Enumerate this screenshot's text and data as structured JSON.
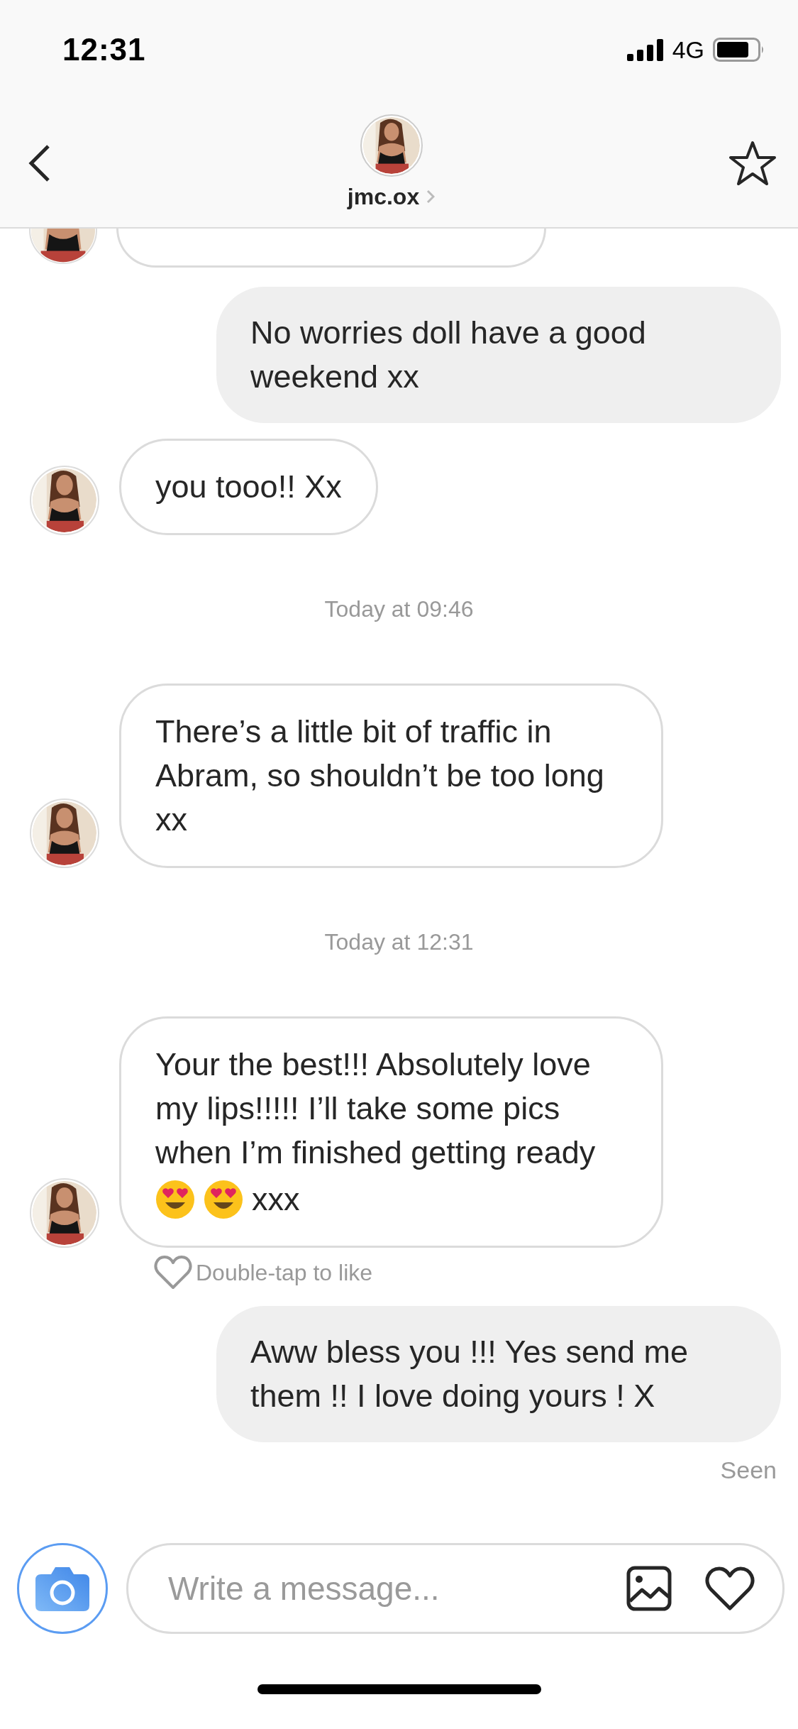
{
  "status_bar": {
    "time": "12:31",
    "network": "4G"
  },
  "header": {
    "username": "jmc.ox"
  },
  "messages": [
    {
      "kind": "partial"
    },
    {
      "kind": "outgoing",
      "parts": [
        {
          "kind": "text",
          "text": "No worries doll have a good weekend xx"
        }
      ]
    },
    {
      "kind": "incoming",
      "parts": [
        {
          "kind": "text",
          "text": "you tooo!! Xx"
        }
      ]
    },
    {
      "kind": "timestamp",
      "text": "Today at 09:46"
    },
    {
      "kind": "incoming",
      "parts": [
        {
          "kind": "text",
          "text": "There’s a little bit of traffic in Abram, so shouldn’t be too long xx"
        }
      ]
    },
    {
      "kind": "timestamp",
      "text": "Today at 12:31"
    },
    {
      "kind": "incoming",
      "parts": [
        {
          "kind": "text",
          "text": "Your the best!!! Absolutely love my lips!!!!! I’ll take some pics when I’m finished getting ready"
        },
        {
          "kind": "emoji"
        },
        {
          "kind": "emoji"
        },
        {
          "kind": "text",
          "text": "xxx"
        }
      ],
      "like_hint": "Double-tap to like"
    },
    {
      "kind": "outgoing",
      "parts": [
        {
          "kind": "text",
          "text": "Aww bless you !!! Yes send me them !! I love doing yours ! X"
        }
      ]
    },
    {
      "kind": "seen",
      "text": "Seen"
    }
  ],
  "composer": {
    "placeholder": "Write a message..."
  }
}
